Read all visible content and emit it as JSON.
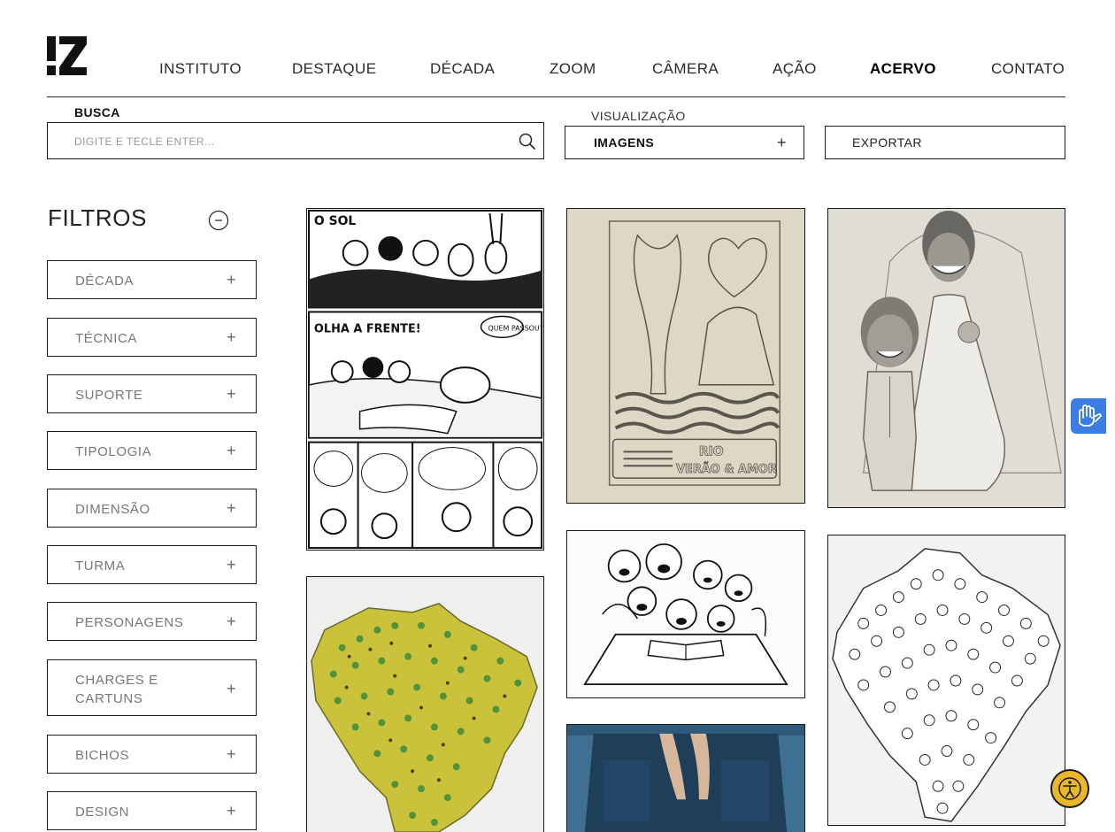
{
  "logo": {
    "text": "IZ",
    "icon": "brand-logo"
  },
  "nav": {
    "items": [
      {
        "label": "INSTITUTO",
        "active": false
      },
      {
        "label": "DESTAQUE",
        "active": false
      },
      {
        "label": "DÉCADA",
        "active": false
      },
      {
        "label": "ZOOM",
        "active": false
      },
      {
        "label": "CÂMERA",
        "active": false
      },
      {
        "label": "AÇÃO",
        "active": false
      },
      {
        "label": "ACERVO",
        "active": true
      },
      {
        "label": "CONTATO",
        "active": false
      }
    ]
  },
  "search": {
    "label": "BUSCA",
    "placeholder": "DIGITE E TECLE ENTER...",
    "value": "",
    "icon": "search-icon"
  },
  "view": {
    "label": "VISUALIZAÇÃO",
    "selected": "IMAGENS",
    "expand_symbol": "+"
  },
  "export": {
    "label": "EXPORTAR"
  },
  "filters": {
    "title": "FILTROS",
    "collapse_symbol": "−",
    "items": [
      {
        "label": "DÉCADA",
        "symbol": "+"
      },
      {
        "label": "TÉCNICA",
        "symbol": "+"
      },
      {
        "label": "SUPORTE",
        "symbol": "+"
      },
      {
        "label": "TIPOLOGIA",
        "symbol": "+"
      },
      {
        "label": "DIMENSÃO",
        "symbol": "+"
      },
      {
        "label": "TURMA",
        "symbol": "+"
      },
      {
        "label": "PERSONAGENS",
        "symbol": "+"
      },
      {
        "label": "CHARGES E CARTUNS",
        "symbol": "+"
      },
      {
        "label": "BICHOS",
        "symbol": "+"
      },
      {
        "label": "DESIGN",
        "symbol": "+"
      }
    ]
  },
  "gallery": {
    "items": [
      {
        "kind": "comic-page",
        "texts": [
          "O SOL",
          "OLHA A FRENTE!",
          "QUEM PASSOU?"
        ]
      },
      {
        "kind": "sketch-poster",
        "texts": [
          "RIO",
          "VERÃO & AMOR"
        ]
      },
      {
        "kind": "caricature-couple"
      },
      {
        "kind": "brazil-map-colored"
      },
      {
        "kind": "kids-reading"
      },
      {
        "kind": "painting-blue"
      },
      {
        "kind": "brazil-map-lineart"
      }
    ]
  },
  "widgets": {
    "libras_icon": "sign-language-hands-icon",
    "accessibility_icon": "accessibility-icon"
  },
  "colors": {
    "text": "#1a1a1a",
    "border": "#1a1a1a",
    "libras_blue": "#3b7de4",
    "accessibility_yellow": "#e8b72e"
  }
}
